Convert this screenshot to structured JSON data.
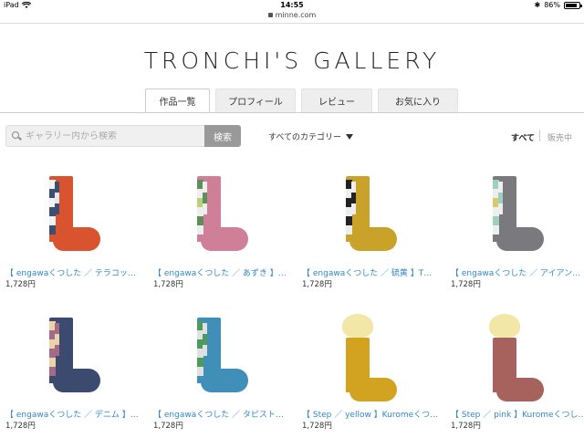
{
  "status_bar": {
    "device": "iPad",
    "time": "14:55",
    "battery": "86%",
    "battery_level": 0.86
  },
  "browser": {
    "url": "minne.com"
  },
  "gallery": {
    "title": "TRONCHI'S GALLERY"
  },
  "tabs": [
    {
      "label": "作品一覧",
      "active": true
    },
    {
      "label": "プロフィール",
      "active": false
    },
    {
      "label": "レビュー",
      "active": false
    },
    {
      "label": "お気に入り",
      "active": false
    }
  ],
  "search": {
    "placeholder": "ギャラリー内から検索",
    "button_label": "検索"
  },
  "category_select": {
    "value": "すべてのカテゴリー"
  },
  "filters": {
    "all": "すべて",
    "on_sale": "販売中"
  },
  "colors": {
    "link": "#2f88c8",
    "button_gray": "#999999"
  },
  "products": [
    {
      "name": "【 engawaくつした ／ テラコッ…",
      "price": "1,728円",
      "color": "#d9532f"
    },
    {
      "name": "【 engawaくつした ／ あずき 】…",
      "price": "1,728円",
      "color": "#cf7f98"
    },
    {
      "name": "【 engawaくつした ／ 硫黄 】T…",
      "price": "1,728円",
      "color": "#c9a22a"
    },
    {
      "name": "【 engawaくつした ／ アイアン…",
      "price": "1,728円",
      "color": "#7a7a7e"
    },
    {
      "name": "【 engawaくつした ／ デニム 】…",
      "price": "1,728円",
      "color": "#3b4a6e"
    },
    {
      "name": "【 engawaくつした ／ タピスト…",
      "price": "1,728円",
      "color": "#3f8fb8"
    },
    {
      "name": "【 Step ／ yellow 】Kuromeくつ…",
      "price": "1,728円",
      "color": "#d2a320"
    },
    {
      "name": "【 Step ／ pink 】Kuromeくつし…",
      "price": "1,728円",
      "color": "#a8625e"
    }
  ]
}
